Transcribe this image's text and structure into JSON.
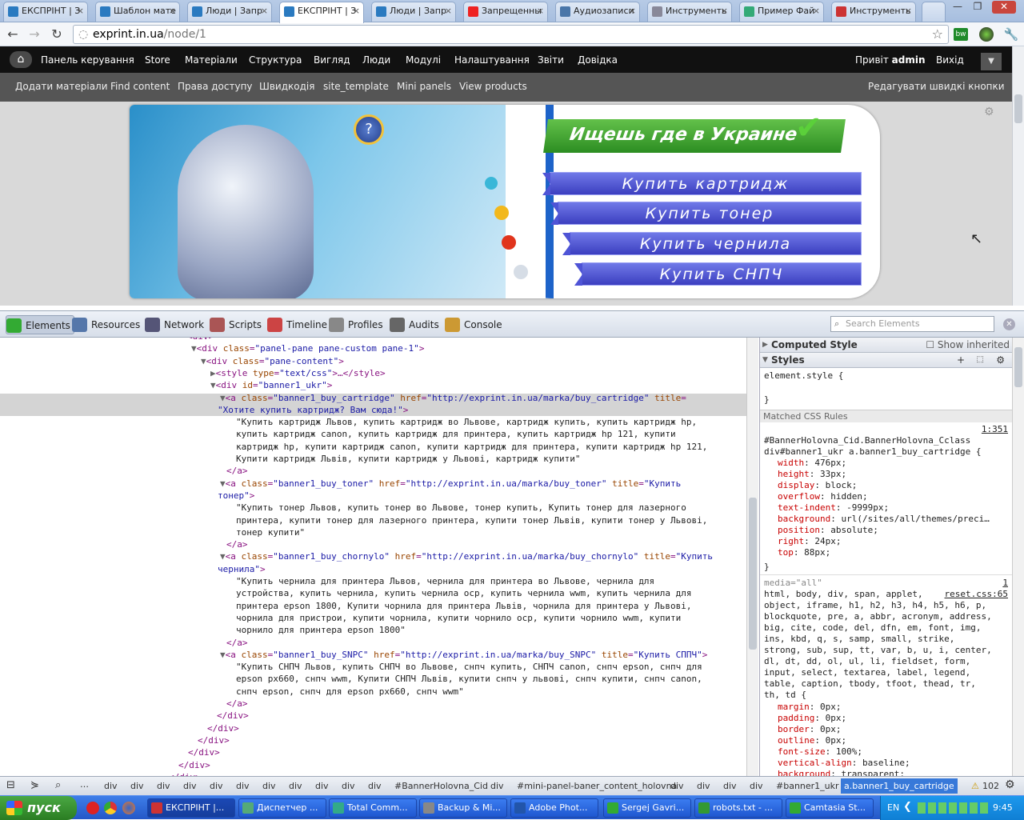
{
  "browser": {
    "tabs": [
      {
        "label": "ЕКСПРІНТ | З",
        "icon": "drupal-icon"
      },
      {
        "label": "Шаблон мате",
        "icon": "drupal-icon"
      },
      {
        "label": "Люди | Запр",
        "icon": "drupal-icon"
      },
      {
        "label": "ЕКСПРІНТ | З",
        "icon": "drupal-icon",
        "active": true
      },
      {
        "label": "Люди | Запр",
        "icon": "drupal-icon"
      },
      {
        "label": "Запрещенны",
        "icon": "youtube-icon"
      },
      {
        "label": "Аудиозаписи",
        "icon": "vk-icon"
      },
      {
        "label": "Инструменть",
        "icon": "page-icon"
      },
      {
        "label": "Пример Фай",
        "icon": "google-icon"
      },
      {
        "label": "Инструменть",
        "icon": "chrome-icon"
      }
    ],
    "url_domain": "exprint.in.ua",
    "url_path": "/node/1"
  },
  "admin_menu": {
    "items": [
      "Панель керування",
      "Store",
      "Матеріали",
      "Структура",
      "Вигляд",
      "Люди",
      "Модулі",
      "Налаштування",
      "Звіти",
      "Довідка"
    ],
    "greeting": "Привіт ",
    "user": "admin",
    "logout": "Вихід"
  },
  "shortcuts": {
    "items": [
      "Додати матеріали",
      "Find content",
      "Права доступу",
      "Швидкодія",
      "site_template",
      "Mini panels",
      "View products"
    ],
    "edit": "Редагувати швидкі кнопки"
  },
  "banner": {
    "headline": "Ищешь где в Украине",
    "buttons": [
      "Купить картридж",
      "Купить тонер",
      "Купить чернила",
      "Купить СНПЧ"
    ]
  },
  "devtools": {
    "tabs": [
      "Elements",
      "Resources",
      "Network",
      "Scripts",
      "Timeline",
      "Profiles",
      "Audits",
      "Console"
    ],
    "search_placeholder": "Search Elements",
    "dom_lines": [
      [
        {
          "c": "tg",
          "t": "<div>"
        }
      ],
      [
        {
          "c": "ar",
          "t": "▼"
        },
        {
          "c": "tg",
          "t": "<div "
        },
        {
          "c": "an",
          "t": "class"
        },
        {
          "c": "tg",
          "t": "="
        },
        {
          "c": "av",
          "t": "\"panel-pane pane-custom pane-1\""
        },
        {
          "c": "tg",
          "t": ">"
        }
      ],
      [
        {
          "c": "ar",
          "t": "▼"
        },
        {
          "c": "tg",
          "t": "<div "
        },
        {
          "c": "an",
          "t": "class"
        },
        {
          "c": "tg",
          "t": "="
        },
        {
          "c": "av",
          "t": "\"pane-content\""
        },
        {
          "c": "tg",
          "t": ">"
        }
      ],
      [
        {
          "c": "ar",
          "t": "▶"
        },
        {
          "c": "tg",
          "t": "<style "
        },
        {
          "c": "an",
          "t": "type"
        },
        {
          "c": "tg",
          "t": "="
        },
        {
          "c": "av",
          "t": "\"text/css\""
        },
        {
          "c": "tg",
          "t": ">…</style>"
        }
      ],
      [
        {
          "c": "ar",
          "t": "▼"
        },
        {
          "c": "tg",
          "t": "<div "
        },
        {
          "c": "an",
          "t": "id"
        },
        {
          "c": "tg",
          "t": "="
        },
        {
          "c": "av",
          "t": "\"banner1_ukr\""
        },
        {
          "c": "tg",
          "t": ">"
        }
      ],
      [
        {
          "c": "ar",
          "t": "▼"
        },
        {
          "c": "tg",
          "t": "<a "
        },
        {
          "c": "an",
          "t": "class"
        },
        {
          "c": "tg",
          "t": "="
        },
        {
          "c": "av",
          "t": "\"banner1_buy_cartridge\""
        },
        {
          "c": "an",
          "t": " href"
        },
        {
          "c": "tg",
          "t": "="
        },
        {
          "c": "av",
          "t": "\"http://exprint.in.ua/marka/buy_cartridge\""
        },
        {
          "c": "an",
          "t": " title"
        },
        {
          "c": "tg",
          "t": "="
        }
      ],
      [
        {
          "c": "av",
          "t": "\"Хотите купить картридж? Вам сюда!\""
        },
        {
          "c": "tg",
          "t": ">"
        }
      ],
      [
        {
          "c": "tx",
          "t": "\"Купить картридж Львов, купить картридж во Львове, картридж купить, купить картридж hp,"
        }
      ],
      [
        {
          "c": "tx",
          "t": "купить картридж canon, купить картридж для принтера, купить картридж hp 121, купити"
        }
      ],
      [
        {
          "c": "tx",
          "t": "картридж hp, купити картридж canon, купити картридж для принтера, купити картридж hp 121,"
        }
      ],
      [
        {
          "c": "tx",
          "t": "Купити картридж Львів, купити картридж у Львові, картридж купити\""
        }
      ],
      [
        {
          "c": "tg",
          "t": "</a>"
        }
      ],
      [
        {
          "c": "ar",
          "t": "▼"
        },
        {
          "c": "tg",
          "t": "<a "
        },
        {
          "c": "an",
          "t": "class"
        },
        {
          "c": "tg",
          "t": "="
        },
        {
          "c": "av",
          "t": "\"banner1_buy_toner\""
        },
        {
          "c": "an",
          "t": " href"
        },
        {
          "c": "tg",
          "t": "="
        },
        {
          "c": "av",
          "t": "\"http://exprint.in.ua/marka/buy_toner\""
        },
        {
          "c": "an",
          "t": " title"
        },
        {
          "c": "tg",
          "t": "="
        },
        {
          "c": "av",
          "t": "\"Купить"
        }
      ],
      [
        {
          "c": "av",
          "t": "тонер\""
        },
        {
          "c": "tg",
          "t": ">"
        }
      ],
      [
        {
          "c": "tx",
          "t": "\"Купить тонер Львов, купить тонер во Львове, тонер купить, Купить тонер для лазерного"
        }
      ],
      [
        {
          "c": "tx",
          "t": "принтера, купити тонер для лазерного принтера, купити тонер Львів, купити тонер у Львові,"
        }
      ],
      [
        {
          "c": "tx",
          "t": "тонер купити\""
        }
      ],
      [
        {
          "c": "tg",
          "t": "</a>"
        }
      ],
      [
        {
          "c": "ar",
          "t": "▼"
        },
        {
          "c": "tg",
          "t": "<a "
        },
        {
          "c": "an",
          "t": "class"
        },
        {
          "c": "tg",
          "t": "="
        },
        {
          "c": "av",
          "t": "\"banner1_buy_chornylo\""
        },
        {
          "c": "an",
          "t": " href"
        },
        {
          "c": "tg",
          "t": "="
        },
        {
          "c": "av",
          "t": "\"http://exprint.in.ua/marka/buy_chornylo\""
        },
        {
          "c": "an",
          "t": " title"
        },
        {
          "c": "tg",
          "t": "="
        },
        {
          "c": "av",
          "t": "\"Купить"
        }
      ],
      [
        {
          "c": "av",
          "t": "чернила\""
        },
        {
          "c": "tg",
          "t": ">"
        }
      ],
      [
        {
          "c": "tx",
          "t": "\"Купить чернила для принтера Львов, чернила для принтера во Львове, чернила для"
        }
      ],
      [
        {
          "c": "tx",
          "t": "устройства, купить чернила, купить чернила оср, купить чернила wwm, купить чернила для"
        }
      ],
      [
        {
          "c": "tx",
          "t": "принтера epson 1800, Купити чорнила для принтера Львів, чорнила для принтера у Львові,"
        }
      ],
      [
        {
          "c": "tx",
          "t": "чорнила для пристрои, купити чорнила, купити чорнило оср, купити чорнило wwm, купити"
        }
      ],
      [
        {
          "c": "tx",
          "t": "чорнило для принтера epson 1800\""
        }
      ],
      [
        {
          "c": "tg",
          "t": "</a>"
        }
      ],
      [
        {
          "c": "ar",
          "t": "▼"
        },
        {
          "c": "tg",
          "t": "<a "
        },
        {
          "c": "an",
          "t": "class"
        },
        {
          "c": "tg",
          "t": "="
        },
        {
          "c": "av",
          "t": "\"banner1_buy_SNPC\""
        },
        {
          "c": "an",
          "t": " href"
        },
        {
          "c": "tg",
          "t": "="
        },
        {
          "c": "av",
          "t": "\"http://exprint.in.ua/marka/buy_SNPC\""
        },
        {
          "c": "an",
          "t": " title"
        },
        {
          "c": "tg",
          "t": "="
        },
        {
          "c": "av",
          "t": "\"Купить СППЧ\""
        },
        {
          "c": "tg",
          "t": ">"
        }
      ],
      [
        {
          "c": "tx",
          "t": "\"Купить СНПЧ Львов, купить СНПЧ во Львове, снпч купить, СНПЧ canon, снпч epson, снпч для"
        }
      ],
      [
        {
          "c": "tx",
          "t": "epson px660, снпч wwm, Купити СНПЧ Львів, купити снпч у львові, снпч купити, снпч canon,"
        }
      ],
      [
        {
          "c": "tx",
          "t": "снпч epson, снпч для epson px660, снпч wwm\""
        }
      ],
      [
        {
          "c": "tg",
          "t": "</a>"
        }
      ],
      [
        {
          "c": "tg",
          "t": "</div>"
        }
      ],
      [
        {
          "c": "tg",
          "t": "</div>"
        }
      ],
      [
        {
          "c": "tg",
          "t": "</div>"
        }
      ],
      [
        {
          "c": "tg",
          "t": "</div>"
        }
      ],
      [
        {
          "c": "tg",
          "t": "</div>"
        }
      ],
      [
        {
          "c": "tg",
          "t": "</div>"
        }
      ],
      [
        {
          "c": "tg",
          "t": "</div>"
        }
      ]
    ],
    "styles_panel": {
      "computed": "Computed Style",
      "show_inherited": "Show inherited",
      "styles": "Styles",
      "element_style": "element.style {",
      "close_brace": "}",
      "matched": "Matched CSS Rules",
      "rule1_link": "1:351",
      "rule1_selector": "#BannerHolovna_Cid.BannerHolovna_Cclass\ndiv#banner1_ukr a.banner1_buy_cartridge {",
      "rule1_props": [
        [
          "width",
          "476px;"
        ],
        [
          "height",
          "33px;"
        ],
        [
          "display",
          "block;"
        ],
        [
          "overflow",
          "hidden;"
        ],
        [
          "text-indent",
          "-9999px;"
        ],
        [
          "background",
          "url(/sites/all/themes/preci…"
        ],
        [
          "position",
          "absolute;"
        ],
        [
          "right",
          "24px;"
        ],
        [
          "top",
          "88px;"
        ]
      ],
      "media": "media=\"all\"",
      "rule2_link": "1",
      "rule2_file": "reset.css:65",
      "rule2_selector": "html, body, div, span, applet,\nobject, iframe, h1, h2, h3, h4, h5, h6, p,\nblockquote, pre, a, abbr, acronym, address,\nbig, cite, code, del, dfn, em, font, img,\nins, kbd, q, s, samp, small, strike,\nstrong, sub, sup, tt, var, b, u, i, center,\ndl, dt, dd, ol, ul, li, fieldset, form,\ninput, select, textarea, label, legend,\ntable, caption, tbody, tfoot, thead, tr,\nth, td {",
      "rule2_props": [
        [
          "margin",
          "0px;"
        ],
        [
          "padding",
          "0px;"
        ],
        [
          "border",
          "0px;"
        ],
        [
          "outline",
          "0px;"
        ],
        [
          "font-size",
          "100%;"
        ],
        [
          "vertical-align",
          "baseline;"
        ],
        [
          "background",
          "transparent;"
        ]
      ]
    },
    "breadcrumbs": [
      "div",
      "div",
      "div",
      "div",
      "div",
      "div",
      "div",
      "div",
      "div",
      "div",
      "div",
      "#BannerHolovna_Cid",
      "div",
      "#mini-panel-baner_content_holovna",
      "div",
      "div",
      "div",
      "div",
      "#banner1_ukr",
      "a.banner1_buy_cartridge"
    ],
    "warnings": "102"
  },
  "taskbar": {
    "start": "пуск",
    "items": [
      "ЕКСПРІНТ |...",
      "Диспетчер ...",
      "Total Comm...",
      "Backup & Mi...",
      "Adobe Phot...",
      "Sergej Gavri...",
      "robots.txt - ...",
      "Camtasia St..."
    ],
    "lang": "EN",
    "time": "9:45"
  }
}
